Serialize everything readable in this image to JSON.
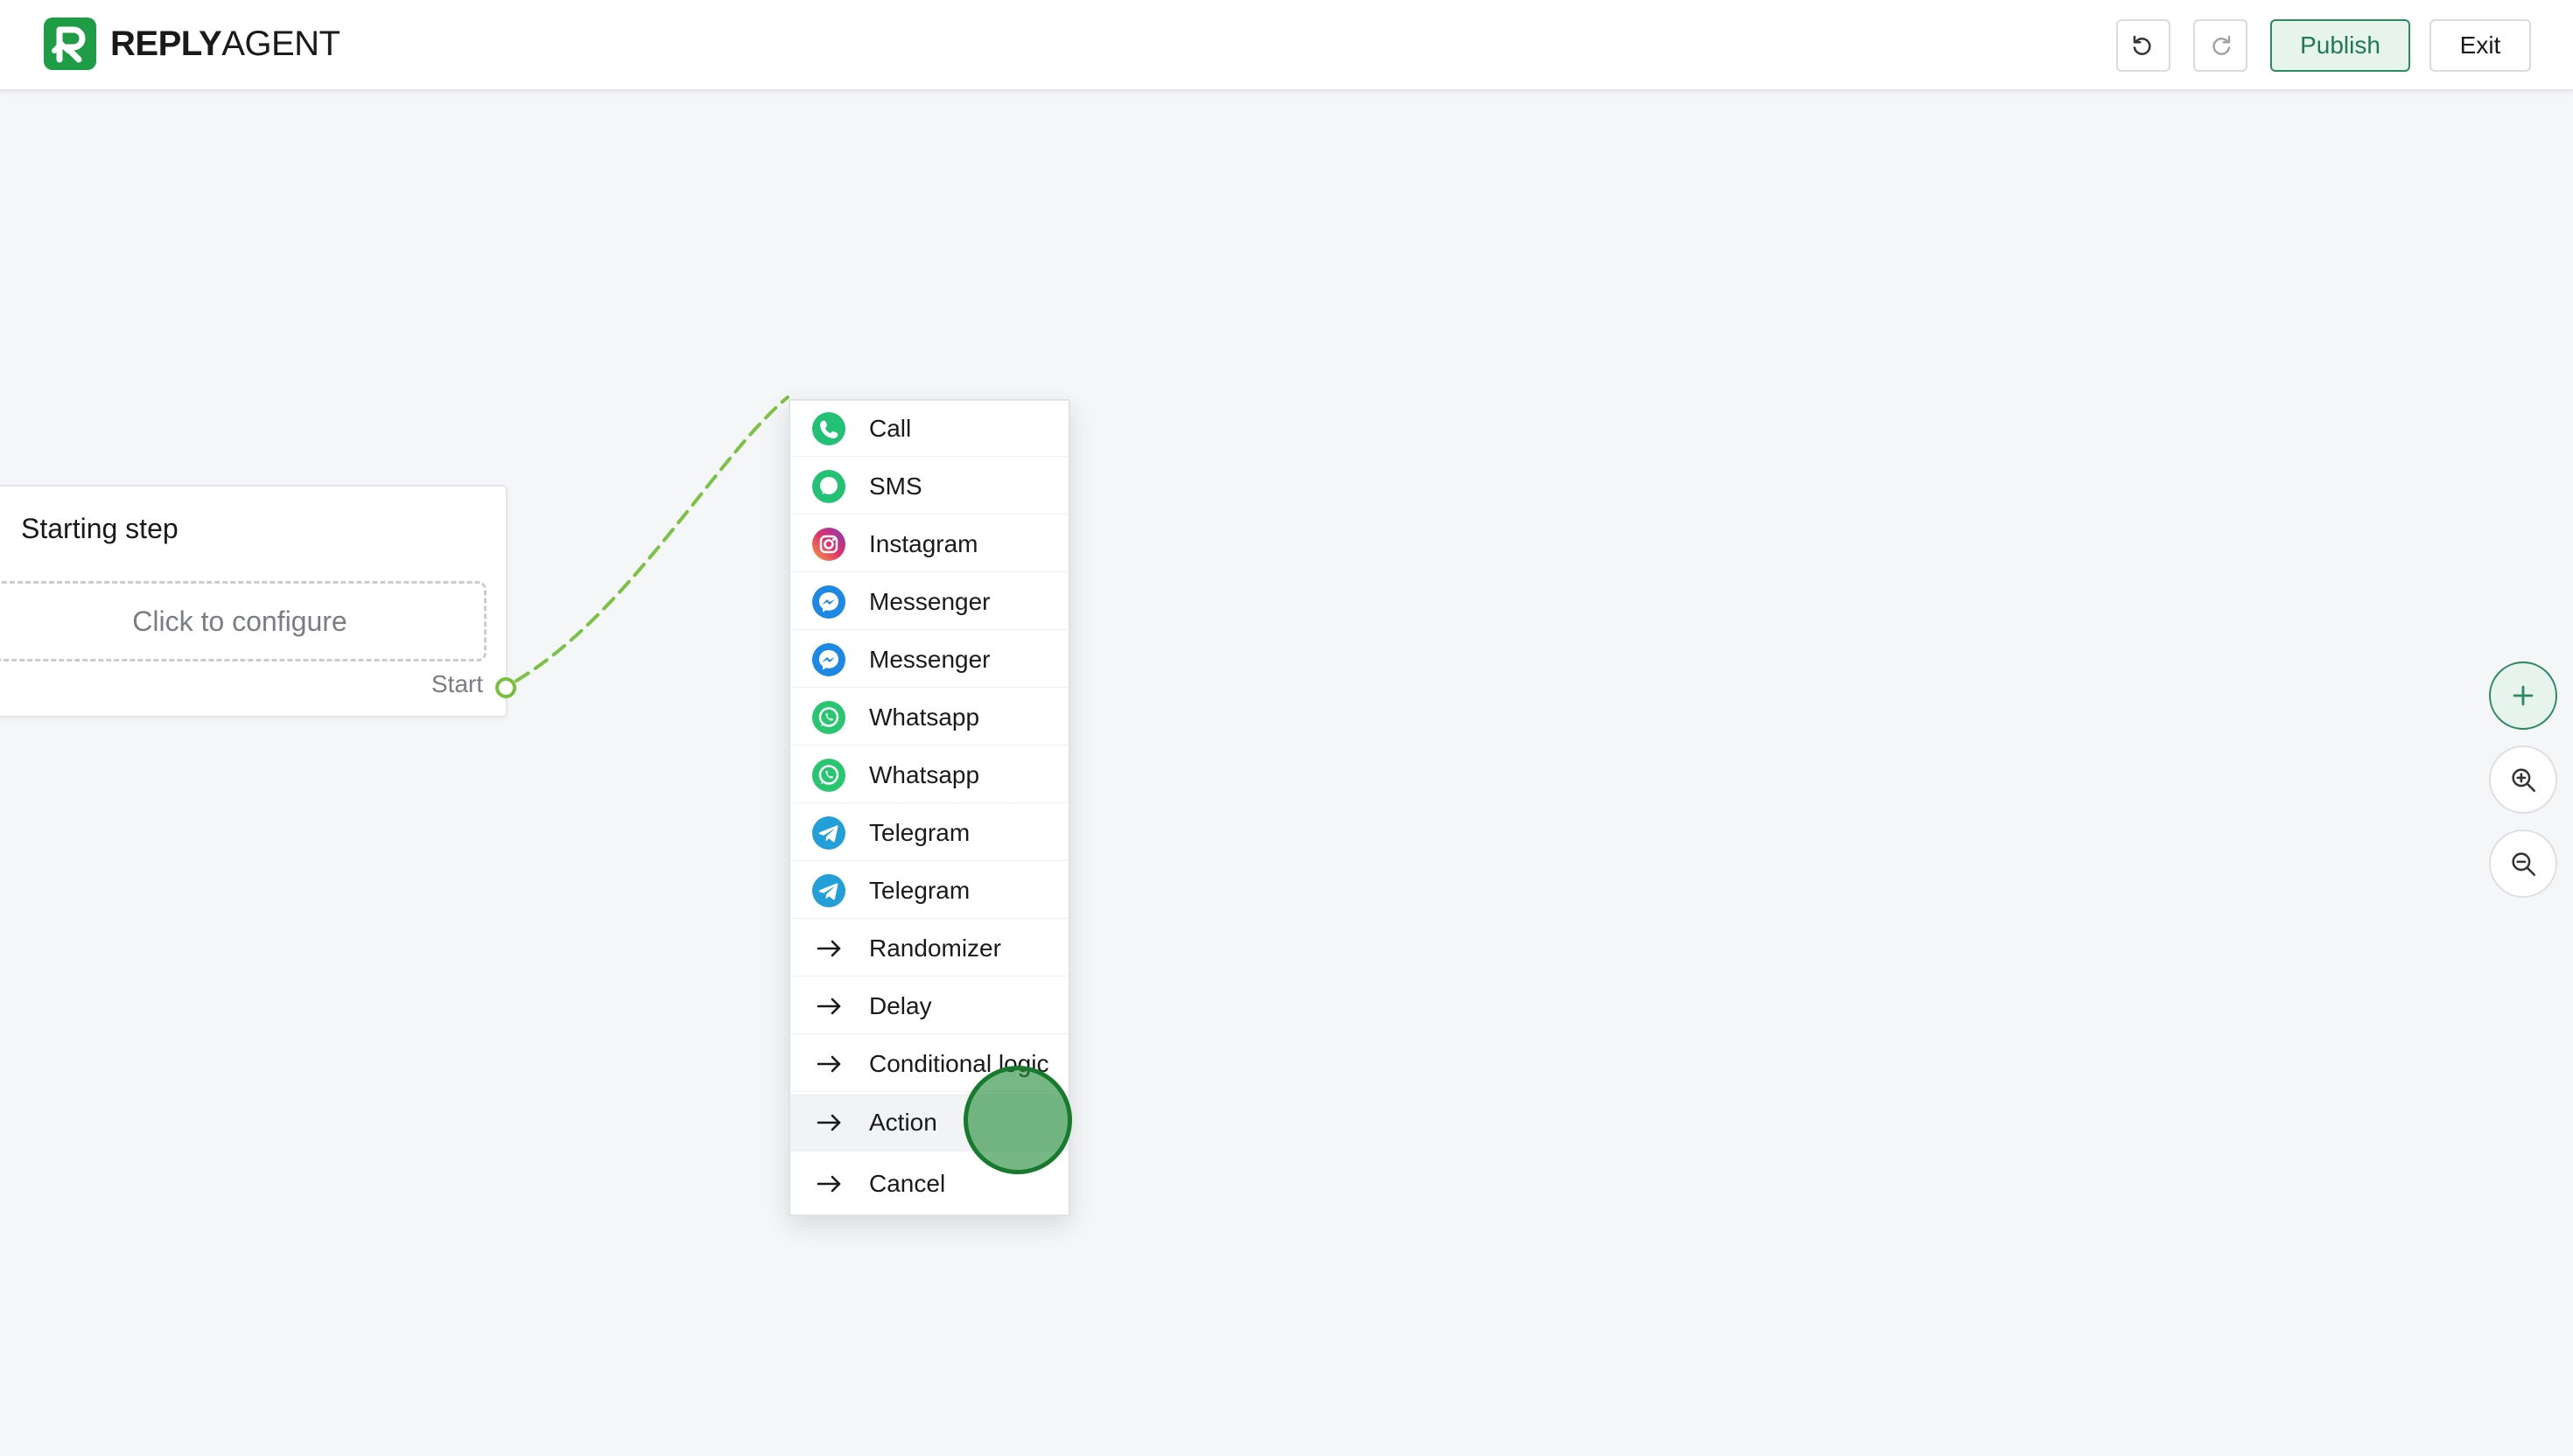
{
  "app": {
    "brand_bold": "REPLY",
    "brand_light": "AGENT",
    "accent": "#2d8a5f",
    "logo_color": "#1f9d46"
  },
  "header": {
    "undo_icon": "undo-icon",
    "redo_icon": "redo-icon",
    "publish_label": "Publish",
    "exit_label": "Exit"
  },
  "canvas": {
    "starting_step": {
      "title": "Starting step",
      "configure_label": "Click to configure",
      "port_label": "Start"
    }
  },
  "menu": {
    "items": [
      {
        "label": "Call",
        "icon": "phone-icon",
        "color": "#25c16f"
      },
      {
        "label": "SMS",
        "icon": "sms-bubble-icon",
        "color": "#25c16f"
      },
      {
        "label": "Instagram",
        "icon": "instagram-icon",
        "color": "#e1306c"
      },
      {
        "label": "Messenger",
        "icon": "messenger-icon",
        "color": "#1e88e5"
      },
      {
        "label": "Messenger",
        "icon": "messenger-icon",
        "color": "#1e88e5"
      },
      {
        "label": "Whatsapp",
        "icon": "whatsapp-icon",
        "color": "#25d366"
      },
      {
        "label": "Whatsapp",
        "icon": "whatsapp-icon",
        "color": "#25d366"
      },
      {
        "label": "Telegram",
        "icon": "telegram-icon",
        "color": "#229ed9"
      },
      {
        "label": "Telegram",
        "icon": "telegram-icon",
        "color": "#229ed9"
      },
      {
        "label": "Randomizer",
        "icon": "arrow-right-icon",
        "color": "#1a1a1a"
      },
      {
        "label": "Delay",
        "icon": "arrow-right-icon",
        "color": "#1a1a1a"
      },
      {
        "label": "Conditional logic",
        "icon": "arrow-right-icon",
        "color": "#1a1a1a"
      },
      {
        "label": "Action",
        "icon": "arrow-right-icon",
        "color": "#1a1a1a"
      },
      {
        "label": "Cancel",
        "icon": "arrow-right-icon",
        "color": "#1a1a1a"
      }
    ]
  },
  "controls": {
    "add_icon": "plus-icon",
    "zoom_in_icon": "zoom-in-icon",
    "zoom_out_icon": "zoom-out-icon"
  }
}
